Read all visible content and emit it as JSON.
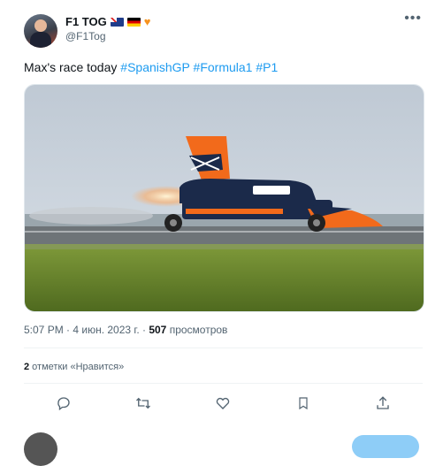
{
  "author": {
    "display_name": "F1 TOG",
    "handle": "@F1Tog",
    "avatar_icon": "profile-avatar",
    "badges": [
      "australia-flag-icon",
      "germany-flag-icon",
      "orange-heart-icon"
    ]
  },
  "tweet": {
    "text_prefix": "Max's race today ",
    "hashtags": [
      "#SpanishGP",
      "#Formula1",
      "#P1"
    ]
  },
  "meta": {
    "time": "5:07 PM",
    "separator": " · ",
    "date": "4 июн. 2023 г.",
    "views_count": "507",
    "views_label": " просмотров"
  },
  "engagement": {
    "likes_count": "2",
    "likes_label": " отметки «Нравится»"
  },
  "actions": [
    "reply-icon",
    "retweet-icon",
    "like-icon",
    "bookmark-icon",
    "share-icon"
  ],
  "colors": {
    "accent": "#1d9bf0",
    "secondary_text": "#536471",
    "car_orange": "#f26a1b",
    "car_navy": "#1b2a4a"
  }
}
